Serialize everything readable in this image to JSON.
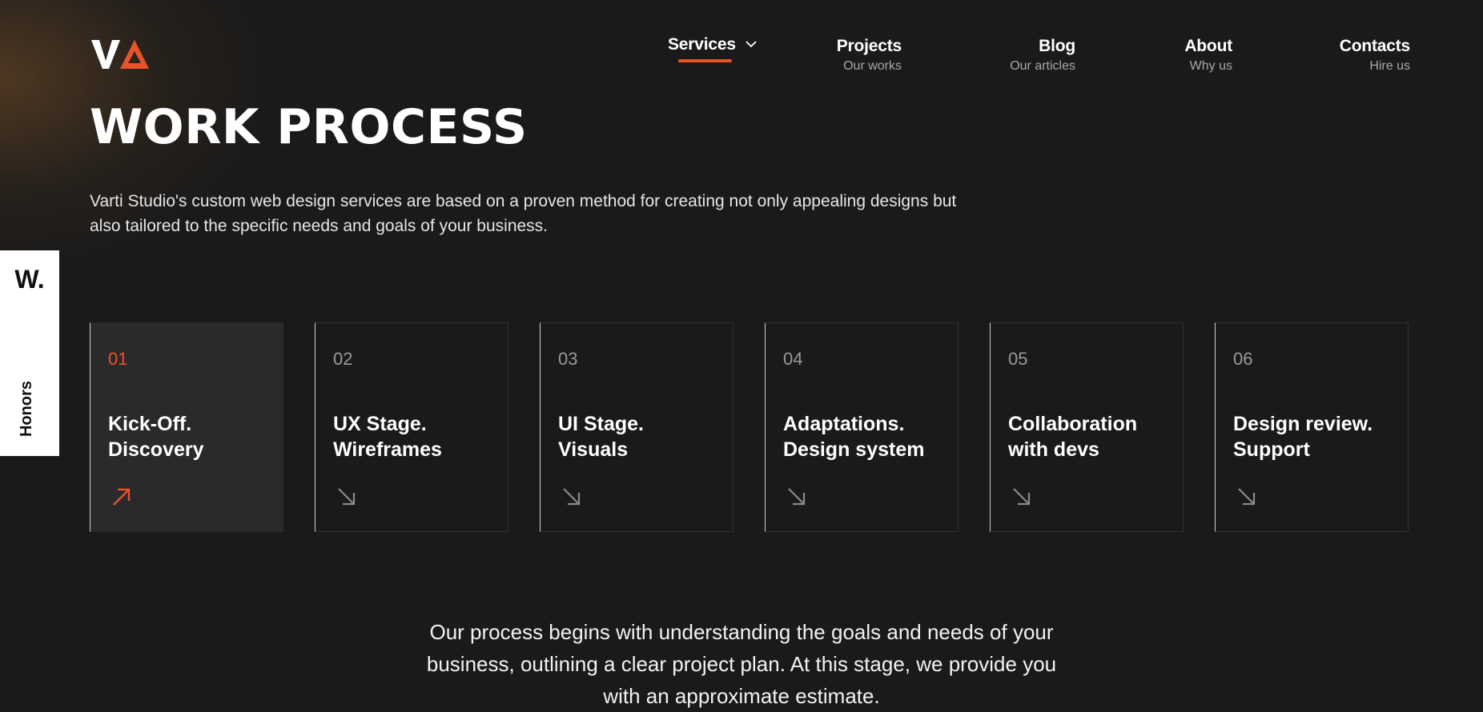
{
  "brand": {
    "logo_text": "VA",
    "accent_color": "#e8542a",
    "background_color": "#1a1a1a"
  },
  "nav": {
    "services": {
      "label": "Services",
      "icon": "chevron-down-icon"
    },
    "projects": {
      "label": "Projects",
      "sub": "Our works"
    },
    "blog": {
      "label": "Blog",
      "sub": "Our articles"
    },
    "about": {
      "label": "About",
      "sub": "Why us"
    },
    "contacts": {
      "label": "Contacts",
      "sub": "Hire us"
    }
  },
  "hero": {
    "title": "WORK PROCESS",
    "intro": "Varti Studio's custom web design services are based on a proven method for creating not only appealing designs but also tailored to the specific needs and goals of your business."
  },
  "side_badge": {
    "mark": "W.",
    "label": "Honors"
  },
  "steps": [
    {
      "number": "01",
      "title_line1": "Kick-Off.",
      "title_line2": "Discovery",
      "active": true,
      "icon": "arrow-up-right-icon"
    },
    {
      "number": "02",
      "title_line1": "UX Stage.",
      "title_line2": "Wireframes",
      "active": false,
      "icon": "arrow-down-right-icon"
    },
    {
      "number": "03",
      "title_line1": "UI Stage.",
      "title_line2": "Visuals",
      "active": false,
      "icon": "arrow-down-right-icon"
    },
    {
      "number": "04",
      "title_line1": "Adaptations.",
      "title_line2": "Design system",
      "active": false,
      "icon": "arrow-down-right-icon"
    },
    {
      "number": "05",
      "title_line1": "Collaboration",
      "title_line2": "with devs",
      "active": false,
      "icon": "arrow-down-right-icon"
    },
    {
      "number": "06",
      "title_line1": "Design review.",
      "title_line2": "Support",
      "active": false,
      "icon": "arrow-down-right-icon"
    }
  ],
  "step_description": "Our process begins with understanding the goals and needs of your business, outlining a clear project plan. At this stage, we provide you with an approximate estimate."
}
